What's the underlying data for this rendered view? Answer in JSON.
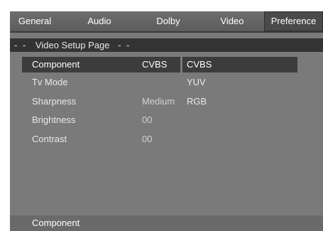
{
  "tabs": [
    {
      "label": "General"
    },
    {
      "label": "Audio"
    },
    {
      "label": "Dolby"
    },
    {
      "label": "Video"
    },
    {
      "label": "Preference"
    }
  ],
  "active_tab": "Preference",
  "page": {
    "title": "Video Setup Page",
    "dash_left": "- -",
    "dash_right": "- -"
  },
  "settings": [
    {
      "label": "Component",
      "value": "CVBS"
    },
    {
      "label": "Tv Mode",
      "value": ""
    },
    {
      "label": "Sharpness",
      "value": "Medium"
    },
    {
      "label": "Brightness",
      "value": "00"
    },
    {
      "label": "Contrast",
      "value": "00"
    }
  ],
  "options": [
    "CVBS",
    "YUV",
    "RGB"
  ],
  "selected_setting": "Component",
  "selected_option": "CVBS",
  "status": {
    "text": "Component"
  },
  "colors": {
    "panel": "#7a7a7a",
    "highlight": "#3c3c3c",
    "page_bar": "#333333",
    "status_bar": "#6a6a6a"
  }
}
